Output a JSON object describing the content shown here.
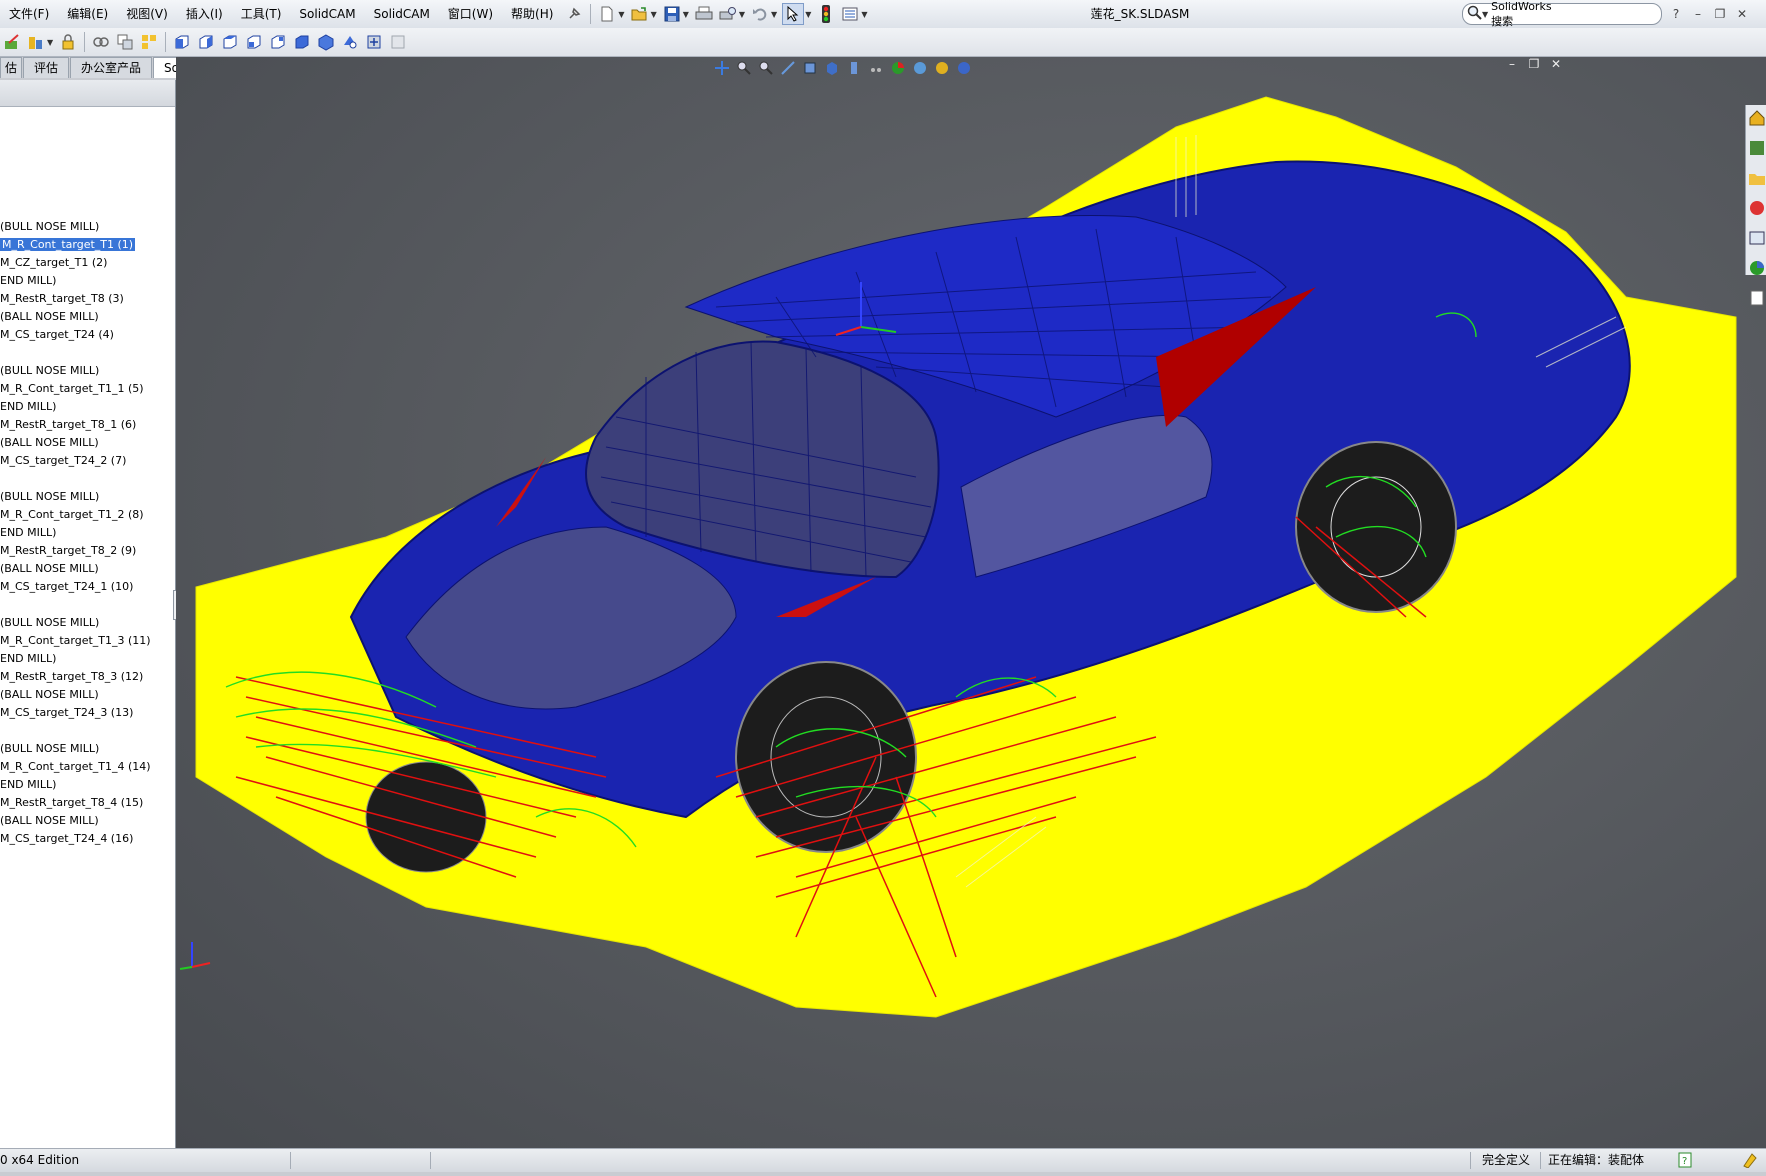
{
  "menu": {
    "items": [
      "文件(F)",
      "编辑(E)",
      "视图(V)",
      "插入(I)",
      "工具(T)",
      "SolidCAM",
      "SolidCAM",
      "窗口(W)",
      "帮助(H)"
    ]
  },
  "window": {
    "title": "莲花_SK.SLDASM"
  },
  "search": {
    "label": "SolidWorks 搜索",
    "placeholder": ""
  },
  "window_controls": {
    "help": "?",
    "minimize": "–",
    "restore": "❐",
    "close": "✕"
  },
  "tabs": [
    "估",
    "评估",
    "办公室产品",
    "SolidCAM"
  ],
  "active_tab": 3,
  "tree": {
    "items": [
      {
        "label": "(BULL NOSE MILL)"
      },
      {
        "label": "M_R_Cont_target_T1 (1)",
        "selected": true
      },
      {
        "label": "M_CZ_target_T1 (2)"
      },
      {
        "label": "END MILL)"
      },
      {
        "label": "M_RestR_target_T8 (3)"
      },
      {
        "label": "(BALL NOSE MILL)"
      },
      {
        "label": "M_CS_target_T24 (4)"
      },
      {
        "label": ""
      },
      {
        "label": "(BULL NOSE MILL)"
      },
      {
        "label": "M_R_Cont_target_T1_1 (5)"
      },
      {
        "label": "END MILL)"
      },
      {
        "label": "M_RestR_target_T8_1 (6)"
      },
      {
        "label": "(BALL NOSE MILL)"
      },
      {
        "label": "M_CS_target_T24_2 (7)"
      },
      {
        "label": ""
      },
      {
        "label": "(BULL NOSE MILL)"
      },
      {
        "label": "M_R_Cont_target_T1_2 (8)"
      },
      {
        "label": "END MILL)"
      },
      {
        "label": "M_RestR_target_T8_2 (9)"
      },
      {
        "label": "(BALL NOSE MILL)"
      },
      {
        "label": "M_CS_target_T24_1 (10)"
      },
      {
        "label": ""
      },
      {
        "label": "(BULL NOSE MILL)"
      },
      {
        "label": "M_R_Cont_target_T1_3 (11)"
      },
      {
        "label": "END MILL)"
      },
      {
        "label": "M_RestR_target_T8_3 (12)"
      },
      {
        "label": "(BALL NOSE MILL)"
      },
      {
        "label": "M_CS_target_T24_3 (13)"
      },
      {
        "label": ""
      },
      {
        "label": "(BULL NOSE MILL)"
      },
      {
        "label": "M_R_Cont_target_T1_4 (14)"
      },
      {
        "label": "END MILL)"
      },
      {
        "label": "M_RestR_target_T8_4 (15)"
      },
      {
        "label": "(BALL NOSE MILL)"
      },
      {
        "label": "M_CS_target_T24_4 (16)"
      }
    ]
  },
  "status": {
    "edition": "0 x64 Edition",
    "definition": "完全定义",
    "editing": "正在编辑：装配体"
  },
  "colors": {
    "stock": "#ffff00",
    "body": "#1a24b0",
    "toolpath_red": "#e01010",
    "toolpath_green": "#22dd22",
    "selection": "#3875d7"
  },
  "icons": {
    "search": "search-icon",
    "new": "new-document-icon",
    "open": "open-folder-icon",
    "save": "save-icon",
    "print": "print-icon",
    "undo": "undo-icon",
    "select": "select-arrow-icon",
    "rebuild": "traffic-light-icon",
    "options": "options-icon"
  }
}
